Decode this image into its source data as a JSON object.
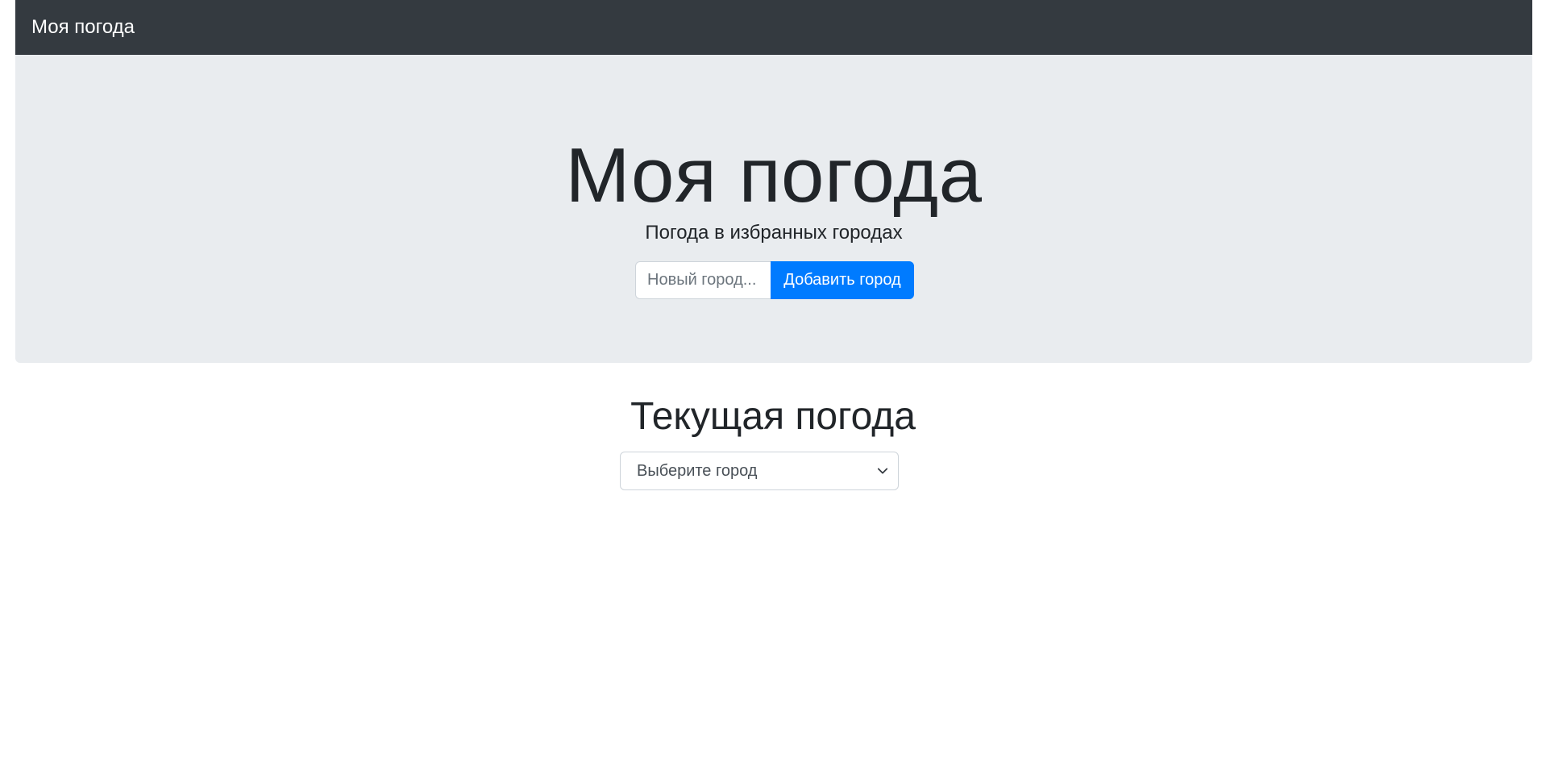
{
  "navbar": {
    "brand": "Моя погода"
  },
  "hero": {
    "title": "Моя погода",
    "subtitle": "Погода в избранных городах",
    "city_input": {
      "value": "",
      "placeholder": "Новый город..."
    },
    "add_button_label": "Добавить город"
  },
  "current": {
    "title": "Текущая погода",
    "select": {
      "selected": "Выберите город",
      "icon": "chevron-down-icon"
    }
  },
  "colors": {
    "navbar_bg": "#343a40",
    "hero_bg": "#e9ecef",
    "primary": "#007bff",
    "text": "#212529"
  }
}
